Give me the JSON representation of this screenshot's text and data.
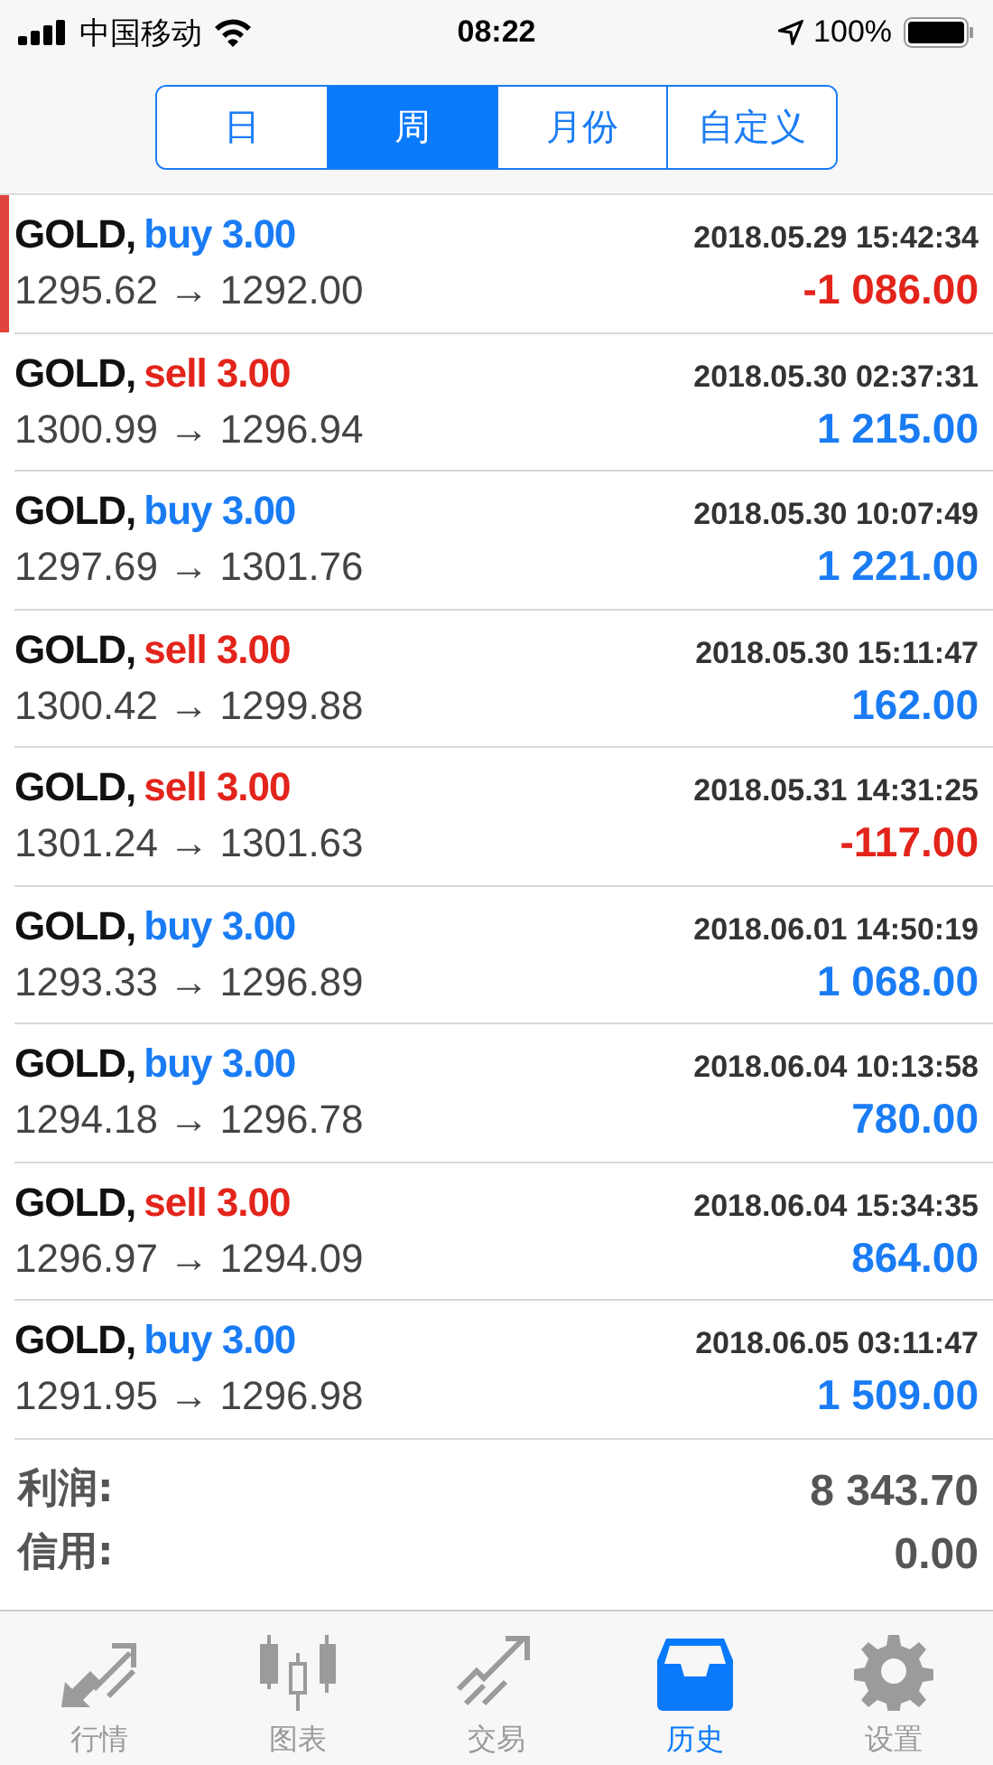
{
  "status_bar": {
    "carrier": "中国移动",
    "time": "08:22",
    "battery": "100%"
  },
  "periods": [
    {
      "label": "日",
      "selected": false
    },
    {
      "label": "周",
      "selected": true
    },
    {
      "label": "月份",
      "selected": false
    },
    {
      "label": "自定义",
      "selected": false
    }
  ],
  "trades": [
    {
      "symbol": "GOLD,",
      "kind": "buy",
      "volume": "buy 3.00",
      "time": "2018.05.29 15:42:34",
      "prices": "1295.62 → 1292.00",
      "profit": "-1 086.00",
      "loss": true,
      "selected": true
    },
    {
      "symbol": "GOLD,",
      "kind": "sell",
      "volume": "sell 3.00",
      "time": "2018.05.30 02:37:31",
      "prices": "1300.99 → 1296.94",
      "profit": "1 215.00",
      "loss": false,
      "selected": false
    },
    {
      "symbol": "GOLD,",
      "kind": "buy",
      "volume": "buy 3.00",
      "time": "2018.05.30 10:07:49",
      "prices": "1297.69 → 1301.76",
      "profit": "1 221.00",
      "loss": false,
      "selected": false
    },
    {
      "symbol": "GOLD,",
      "kind": "sell",
      "volume": "sell 3.00",
      "time": "2018.05.30 15:11:47",
      "prices": "1300.42 → 1299.88",
      "profit": "162.00",
      "loss": false,
      "selected": false
    },
    {
      "symbol": "GOLD,",
      "kind": "sell",
      "volume": "sell 3.00",
      "time": "2018.05.31 14:31:25",
      "prices": "1301.24 → 1301.63",
      "profit": "-117.00",
      "loss": true,
      "selected": false
    },
    {
      "symbol": "GOLD,",
      "kind": "buy",
      "volume": "buy 3.00",
      "time": "2018.06.01 14:50:19",
      "prices": "1293.33 → 1296.89",
      "profit": "1 068.00",
      "loss": false,
      "selected": false
    },
    {
      "symbol": "GOLD,",
      "kind": "buy",
      "volume": "buy 3.00",
      "time": "2018.06.04 10:13:58",
      "prices": "1294.18 → 1296.78",
      "profit": "780.00",
      "loss": false,
      "selected": false
    },
    {
      "symbol": "GOLD,",
      "kind": "sell",
      "volume": "sell 3.00",
      "time": "2018.06.04 15:34:35",
      "prices": "1296.97 → 1294.09",
      "profit": "864.00",
      "loss": false,
      "selected": false
    },
    {
      "symbol": "GOLD,",
      "kind": "buy",
      "volume": "buy 3.00",
      "time": "2018.06.05 03:11:47",
      "prices": "1291.95 → 1296.98",
      "profit": "1 509.00",
      "loss": false,
      "selected": false
    }
  ],
  "summary": [
    {
      "label": "利润:",
      "value": "8 343.70"
    },
    {
      "label": "信用:",
      "value": "0.00"
    }
  ],
  "tabs": [
    {
      "kind": "quotes",
      "label": "行情",
      "selected": false
    },
    {
      "kind": "chart",
      "label": "图表",
      "selected": false
    },
    {
      "kind": "trade",
      "label": "交易",
      "selected": false
    },
    {
      "kind": "history",
      "label": "历史",
      "selected": true
    },
    {
      "kind": "settings",
      "label": "设置",
      "selected": false
    }
  ]
}
